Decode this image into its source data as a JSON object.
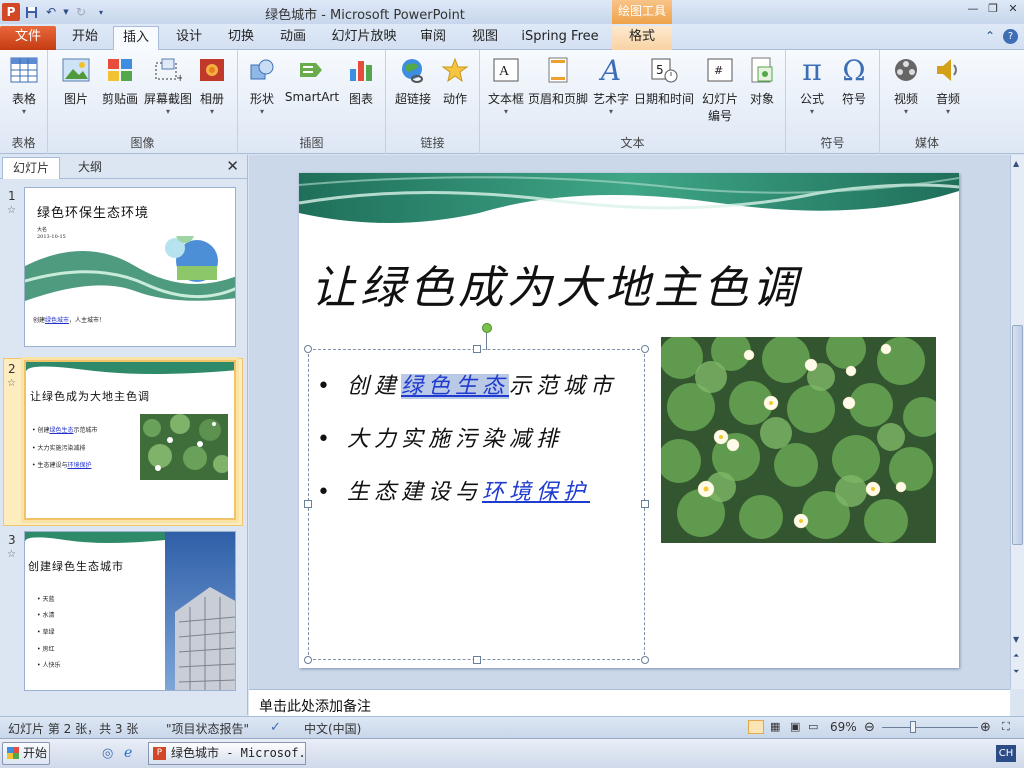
{
  "window": {
    "title": "绿色城市 - Microsoft PowerPoint",
    "app_badge": "P",
    "tool_tab_header": "绘图工具"
  },
  "tabs": [
    {
      "label": "文件",
      "active": false
    },
    {
      "label": "开始",
      "active": false
    },
    {
      "label": "插入",
      "active": true
    },
    {
      "label": "设计",
      "active": false
    },
    {
      "label": "切换",
      "active": false
    },
    {
      "label": "动画",
      "active": false
    },
    {
      "label": "幻灯片放映",
      "active": false
    },
    {
      "label": "审阅",
      "active": false
    },
    {
      "label": "视图",
      "active": false
    },
    {
      "label": "iSpring Free",
      "active": false
    },
    {
      "label": "格式",
      "active": false
    }
  ],
  "ribbon": {
    "groups": [
      {
        "label": "表格",
        "buttons": [
          {
            "label": "表格",
            "icon": "table-icon"
          }
        ]
      },
      {
        "label": "图像",
        "buttons": [
          {
            "label": "图片",
            "icon": "picture-icon"
          },
          {
            "label": "剪贴画",
            "icon": "clipart-icon"
          },
          {
            "label": "屏幕截图",
            "icon": "screenshot-icon"
          },
          {
            "label": "相册",
            "icon": "photo-album-icon"
          }
        ]
      },
      {
        "label": "插图",
        "buttons": [
          {
            "label": "形状",
            "icon": "shapes-icon"
          },
          {
            "label": "SmartArt",
            "icon": "smartart-icon"
          },
          {
            "label": "图表",
            "icon": "chart-icon"
          }
        ]
      },
      {
        "label": "链接",
        "buttons": [
          {
            "label": "超链接",
            "icon": "hyperlink-icon"
          },
          {
            "label": "动作",
            "icon": "action-icon"
          }
        ]
      },
      {
        "label": "文本",
        "buttons": [
          {
            "label": "文本框",
            "icon": "textbox-icon"
          },
          {
            "label": "页眉和页脚",
            "icon": "header-footer-icon"
          },
          {
            "label": "艺术字",
            "icon": "wordart-icon"
          },
          {
            "label": "日期和时间",
            "icon": "datetime-icon"
          },
          {
            "label": "幻灯片",
            "label2": "编号",
            "icon": "slide-number-icon"
          },
          {
            "label": "对象",
            "icon": "object-icon"
          }
        ]
      },
      {
        "label": "符号",
        "buttons": [
          {
            "label": "公式",
            "icon": "equation-icon"
          },
          {
            "label": "符号",
            "icon": "symbol-icon"
          }
        ]
      },
      {
        "label": "媒体",
        "buttons": [
          {
            "label": "视频",
            "icon": "video-icon"
          },
          {
            "label": "音频",
            "icon": "audio-icon"
          }
        ]
      }
    ]
  },
  "panel": {
    "tabs": [
      "幻灯片",
      "大纲"
    ],
    "close": "✕",
    "thumbnails": [
      {
        "num": "1",
        "title": "绿色环保生态环境",
        "author": "大名",
        "date": "2013-10-15",
        "footer_pre": "创建",
        "footer_link": "绿色城市",
        "footer_post": "，人主城市！"
      },
      {
        "num": "2",
        "title": "让绿色成为大地主色调",
        "bullets": [
          {
            "pre": "创建",
            "link": "绿色生态",
            "post": "示范城市"
          },
          {
            "pre": "大力实施污染减排",
            "link": "",
            "post": ""
          },
          {
            "pre": "生态建设与",
            "link": "环境保护",
            "post": ""
          }
        ]
      },
      {
        "num": "3",
        "title": "创建绿色生态城市",
        "bullets": [
          "天蓝",
          "水清",
          "草绿",
          "房红",
          "人快乐"
        ]
      }
    ]
  },
  "slide": {
    "title": "让绿色成为大地主色调",
    "bullets": [
      {
        "pre": "创建",
        "link": "绿色生态",
        "post": "示范城市",
        "highlight": true
      },
      {
        "pre": "大力实施污染减排",
        "link": "",
        "post": "",
        "highlight": false
      },
      {
        "pre": "生态建设与",
        "link": "环境保护",
        "post": "",
        "highlight": false
      }
    ],
    "image": "water-lily-photo"
  },
  "notes": {
    "placeholder": "单击此处添加备注"
  },
  "status": {
    "slide_info": "幻灯片 第 2 张，共 3 张",
    "theme": "\"项目状态报告\"",
    "language": "中文(中国)",
    "zoom": "69%"
  },
  "taskbar": {
    "start": "开始",
    "item": "绿色城市 - Microsof...",
    "ime": "CH"
  },
  "colors": {
    "file_tab": "#d24726",
    "drawing_tools": "#efa248",
    "hyperlink": "#1f3bd0",
    "rotation_handle": "#7bc24a"
  }
}
